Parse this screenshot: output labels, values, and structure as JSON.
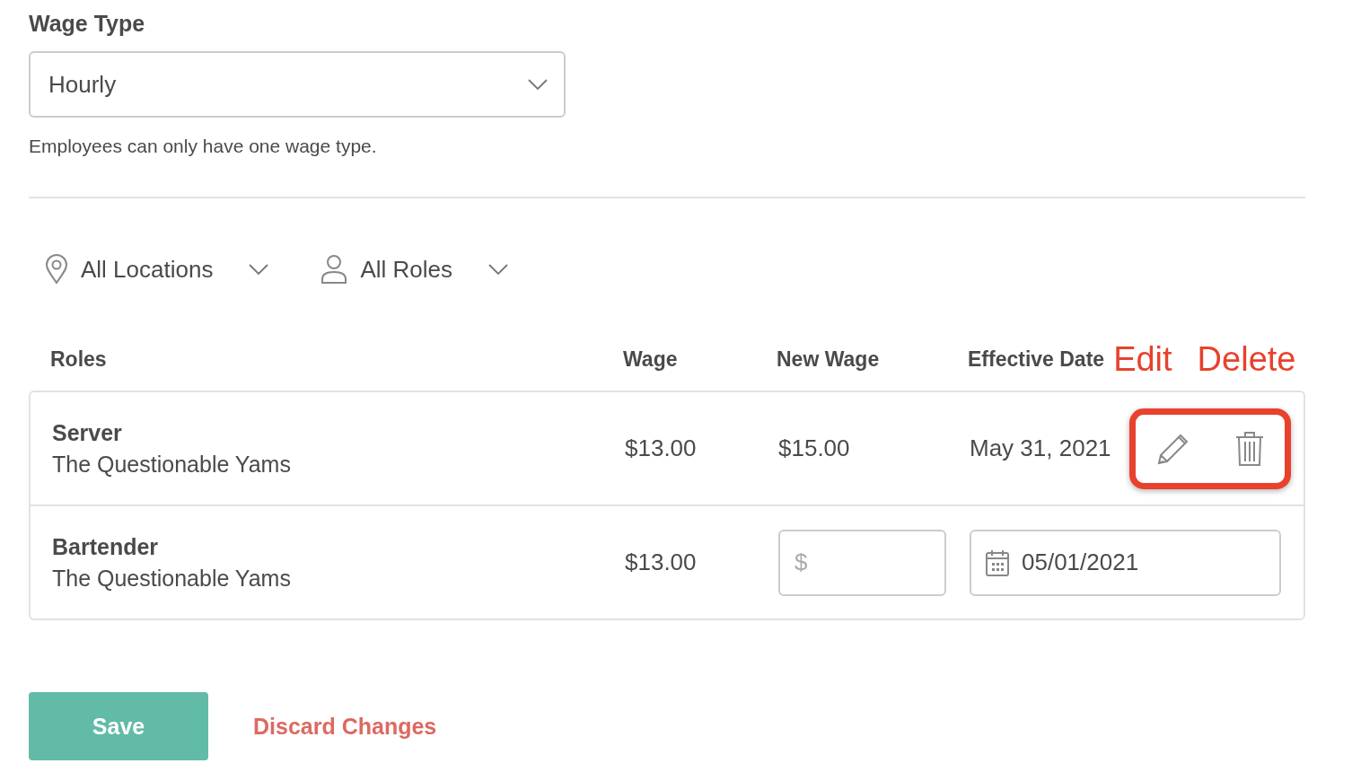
{
  "wage_type": {
    "label": "Wage Type",
    "value": "Hourly",
    "hint": "Employees can only have one wage type."
  },
  "filters": [
    {
      "kind": "location",
      "label": "All Locations"
    },
    {
      "kind": "role",
      "label": "All Roles"
    }
  ],
  "table": {
    "columns": [
      "Roles",
      "Wage",
      "New Wage",
      "Effective Date"
    ],
    "annotations": [
      "Edit",
      "Delete"
    ],
    "rows": [
      {
        "kind": "scheduled",
        "role": "Server",
        "location": "The Questionable Yams",
        "wage": "$13.00",
        "new_wage": "$15.00",
        "effective_date": "May 31, 2021"
      },
      {
        "kind": "editable",
        "role": "Bartender",
        "location": "The Questionable Yams",
        "wage": "$13.00",
        "new_wage_placeholder": "$",
        "effective_date": "05/01/2021"
      }
    ]
  },
  "buttons": {
    "save": "Save",
    "discard": "Discard Changes"
  }
}
